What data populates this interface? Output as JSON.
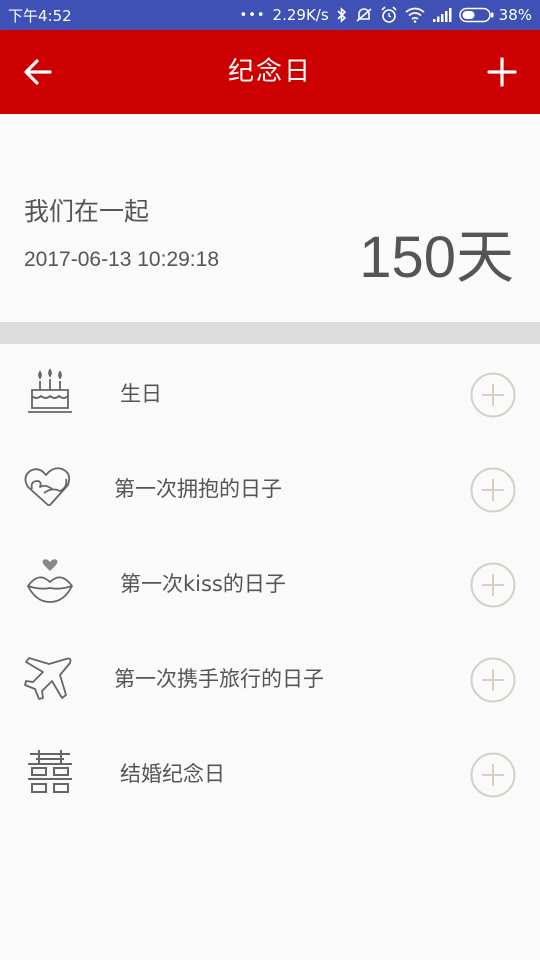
{
  "status_bar": {
    "time": "下午4:52",
    "dots": "•••",
    "speed": "2.29K/s",
    "battery": "38%"
  },
  "app_bar": {
    "title": "纪念日"
  },
  "together": {
    "name": "我们在一起",
    "date": "2017-06-13 10:29:18",
    "days": "150天"
  },
  "anniversaries": [
    {
      "label": "生日",
      "icon": "cake-icon"
    },
    {
      "label": "第一次拥抱的日子",
      "icon": "hug-heart-icon"
    },
    {
      "label": "第一次kiss的日子",
      "icon": "lips-icon"
    },
    {
      "label": "第一次携手旅行的日子",
      "icon": "airplane-icon"
    },
    {
      "label": "结婚纪念日",
      "icon": "double-happiness-icon"
    }
  ],
  "colors": {
    "status_bar": "#3f51b5",
    "app_bar": "#cc0000",
    "divider": "#dcdcdc",
    "plus_circle": "#d8cfc4"
  }
}
